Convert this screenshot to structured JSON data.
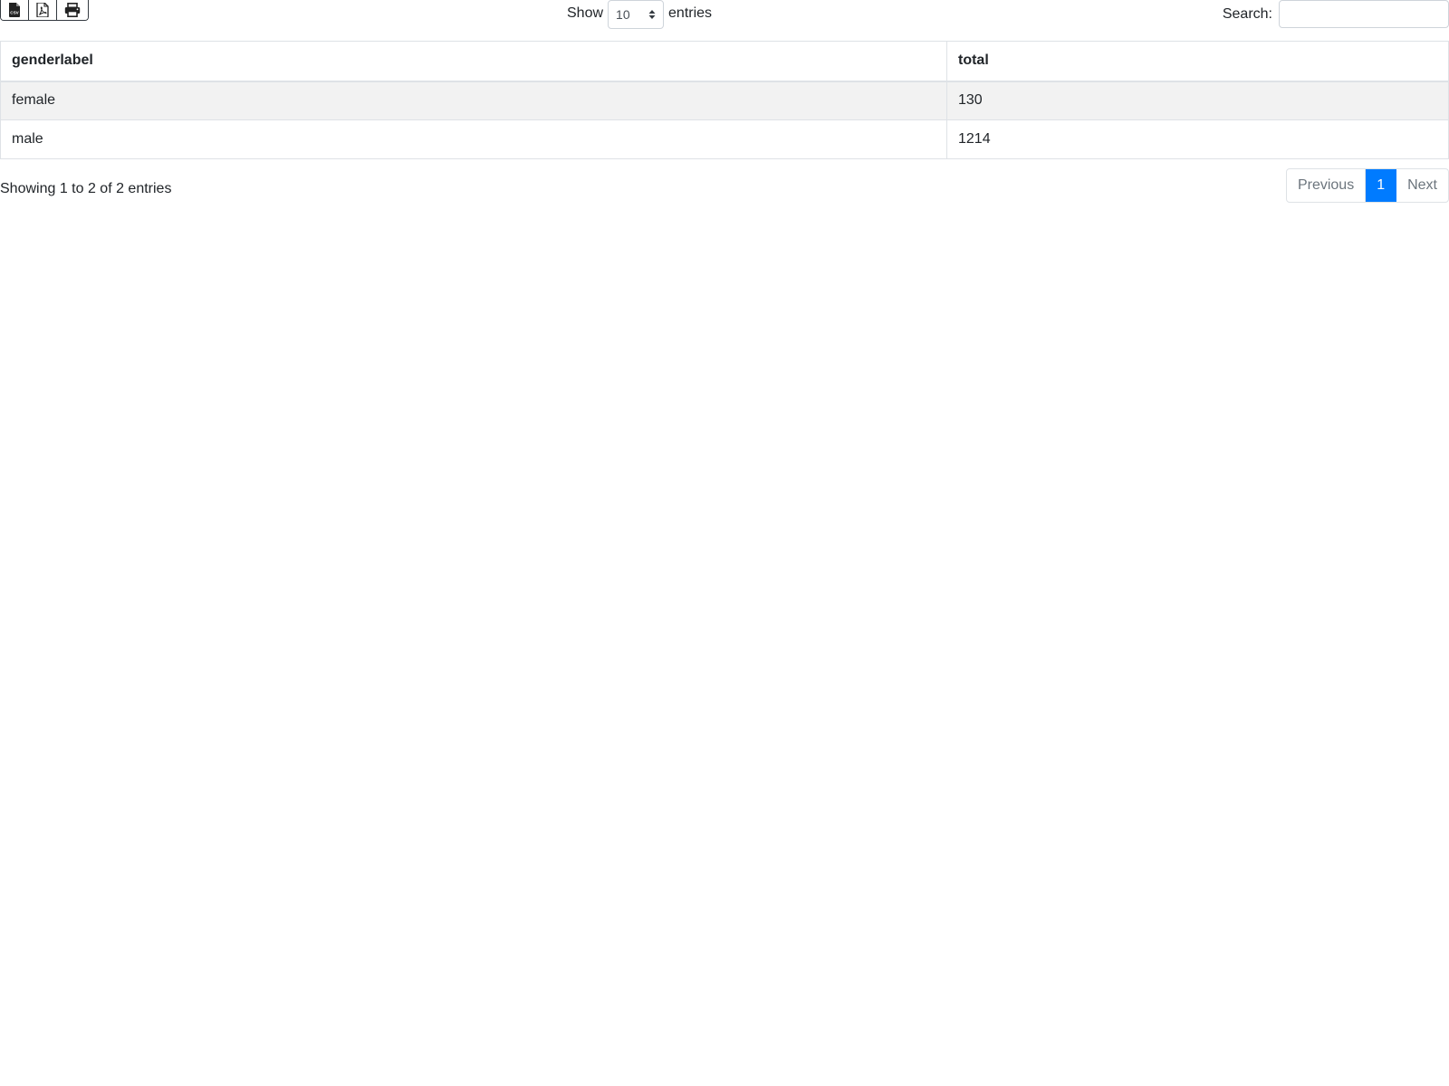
{
  "toolbar": {
    "buttons": [
      {
        "icon": "csv-file-icon"
      },
      {
        "icon": "pdf-file-icon"
      },
      {
        "icon": "print-icon"
      }
    ]
  },
  "length": {
    "prefix": "Show",
    "value": "10",
    "suffix": "entries"
  },
  "search": {
    "label": "Search:",
    "value": "",
    "placeholder": ""
  },
  "table": {
    "headers": [
      "genderlabel",
      "total"
    ],
    "rows": [
      [
        "female",
        "130"
      ],
      [
        "male",
        "1214"
      ]
    ]
  },
  "info": "Showing 1 to 2 of 2 entries",
  "pagination": {
    "previous": "Previous",
    "current": "1",
    "next": "Next"
  },
  "colors": {
    "accent": "#007bff",
    "striped_row": "#f2f2f2"
  }
}
